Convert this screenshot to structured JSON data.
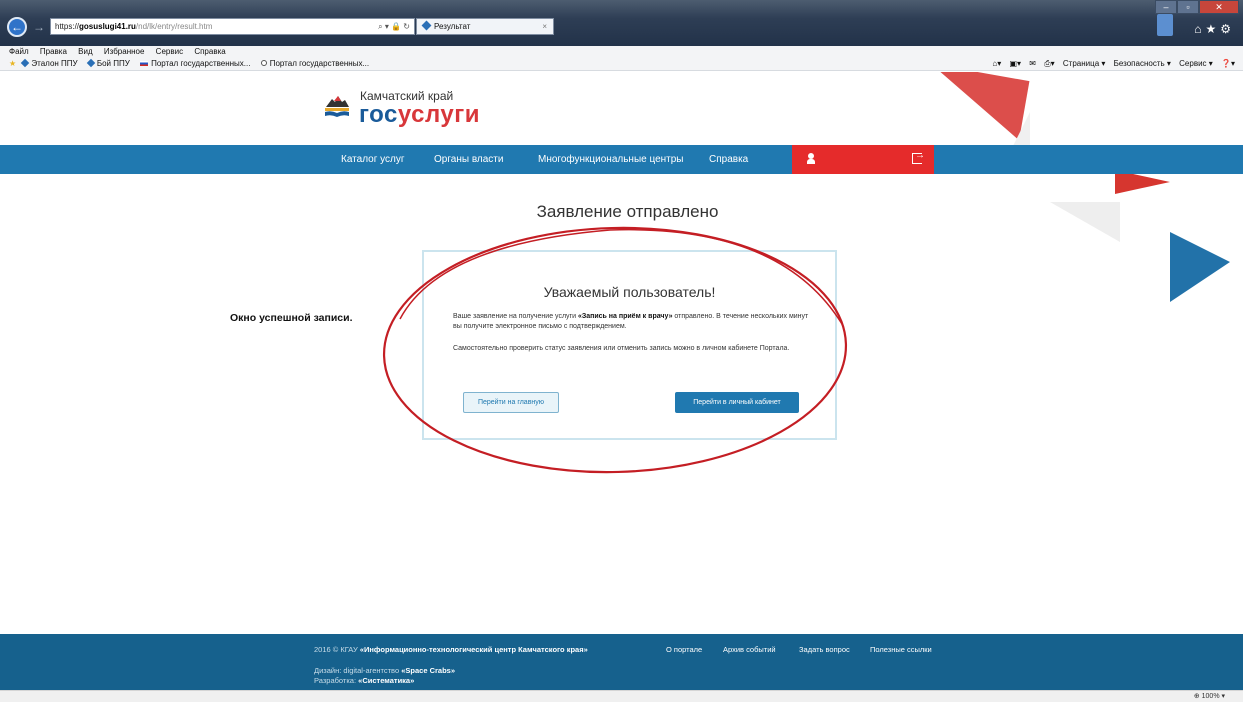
{
  "browser": {
    "url_scheme": "https://",
    "url_domain": "gosuslugi41.ru",
    "url_path": "/nd/lk/entry/result.htm",
    "address_icons": "⌕ ▾ 🔒 ↻",
    "tab_title": "Результат",
    "tab_close": "×",
    "menu": [
      "Файл",
      "Правка",
      "Вид",
      "Избранное",
      "Сервис",
      "Справка"
    ],
    "favorites": [
      "Эталон ППУ",
      "Бой ППУ",
      "Портал государственных...",
      "Портал государственных..."
    ],
    "command_bar": [
      "Страница ▾",
      "Безопасность ▾",
      "Сервис ▾"
    ],
    "zoom": "⊕ 100%  ▾"
  },
  "site": {
    "region": "Камчатский край",
    "brand_part1": "гос",
    "brand_part2": "услуги",
    "nav": [
      "Каталог услуг",
      "Органы власти",
      "Многофункциональные центры",
      "Справка"
    ]
  },
  "main": {
    "page_title": "Заявление отправлено",
    "side_note": "Окно успешной записи.",
    "card": {
      "title": "Уважаемый пользователь!",
      "p1_before": "Ваше заявление на получение услуги ",
      "p1_service": "«Запись на приём к врачу»",
      "p1_after": " отправлено. В течение нескольких минут вы получите электронное письмо с подтверждением.",
      "p2": "Самостоятельно проверить статус заявления или отменить запись можно в личном кабинете Портала.",
      "btn_home": "Перейти на главную",
      "btn_cabinet": "Перейти в личный кабинет"
    }
  },
  "footer": {
    "copy_prefix": "2016 © КГАУ ",
    "copy_org": "«Информационно-технологический центр Камчатского края»",
    "design_prefix": "Дизайн: digital-агентство ",
    "design_agency": "«Space Crabs»",
    "dev_prefix": "Разработка: ",
    "dev_company": "«Систематика»",
    "links": [
      "О портале",
      "Архив событий",
      "Задать вопрос",
      "Полезные ссылки"
    ]
  },
  "colors": {
    "nav_blue": "#2079b0",
    "footer_blue": "#16618d",
    "user_red": "#e52b2b",
    "annotation_red": "#c41e24"
  }
}
